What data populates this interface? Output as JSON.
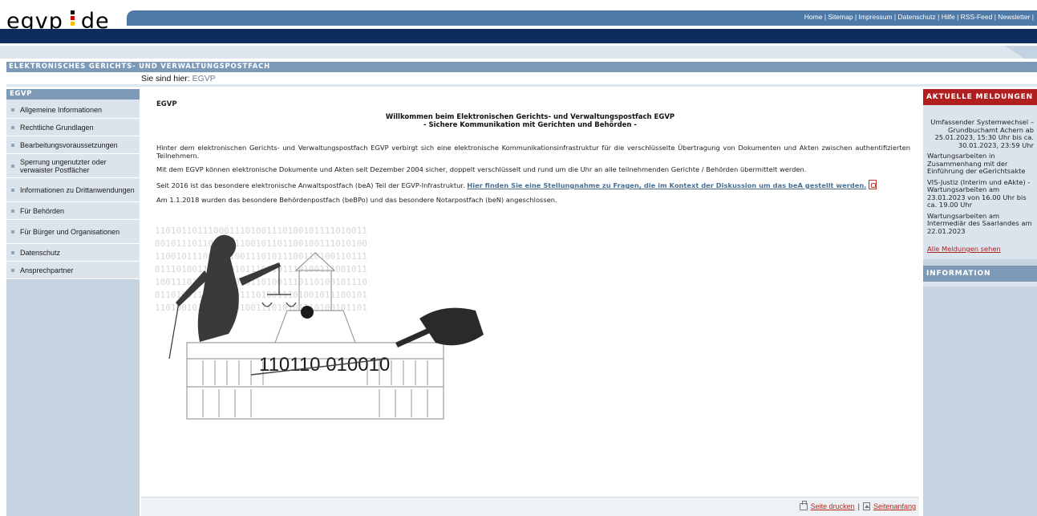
{
  "header": {
    "logo_left": "egvp",
    "logo_right": "de",
    "top_links": [
      "Home",
      "Sitemap",
      "Impressum",
      "Datenschutz",
      "Hilfe",
      "RSS-Feed",
      "Newsletter"
    ]
  },
  "title_bar": "ELEKTRONISCHES GERICHTS- UND VERWALTUNGSPOSTFACH",
  "breadcrumb": {
    "label": "Sie sind hier:",
    "current": "EGVP"
  },
  "sidebar": {
    "heading": "EGVP",
    "items": [
      {
        "label": "Allgemeine Informationen"
      },
      {
        "label": "Rechtliche Grundlagen"
      },
      {
        "label": "Bearbeitungsvoraussetzungen"
      },
      {
        "label": "Sperrung ungenutzter oder verwaister Postfächer"
      },
      {
        "label": "Informationen zu Drittanwendungen"
      },
      {
        "label": "Für Behörden"
      },
      {
        "label": "Für Bürger und Organisationen"
      },
      {
        "label": "Datenschutz"
      },
      {
        "label": "Ansprechpartner"
      }
    ]
  },
  "main": {
    "heading": "EGVP",
    "welcome_line1": "Willkommen beim Elektronischen Gerichts- und Verwaltungspostfach EGVP",
    "welcome_line2": "- Sichere Kommunikation mit Gerichten und Behörden -",
    "p1": "Hinter dem elektronischen Gerichts- und Verwaltungspostfach EGVP verbirgt sich eine elektronische Kommunikationsinfrastruktur für die verschlüsselte Übertragung von Dokumenten und Akten zwischen authentifizierten Teilnehmern.",
    "p2": "Mit dem EGVP können elektronische Dokumente und Akten seit Dezember 2004 sicher, doppelt verschlüsselt und rund um die Uhr an alle teilnehmenden Gerichte / Behörden übermittelt werden.",
    "p3_text": "Seit 2016 ist das besondere elektronische Anwaltspostfach (beA) Teil der EGVP-Infrastruktur. ",
    "p3_link": "Hier finden Sie eine Stellungnahme zu Fragen, die im Kontext der Diskussion um das beA gestellt werden.",
    "p4": "Am 1.1.2018 wurden das besondere Behördenpostfach (beBPo) und das besondere Notarpostfach (beN) angeschlossen.",
    "image_binary_text": "110110 010010",
    "pdf_icon": "pdf-icon"
  },
  "footer": {
    "print_label": "Seite drucken",
    "separator": "|",
    "top_label": "Seitenanfang"
  },
  "right": {
    "news_heading": "AKTUELLE MELDUNGEN",
    "news": [
      "Umfassender Systemwechsel – Grundbuchamt Achern ab 25.01.2023, 15:30 Uhr bis ca. 30.01.2023, 23:59 Uhr",
      "Wartungsarbeiten in Zusammenhang mit der Einführung der eGerichtsakte",
      "VIS-Justiz (Interim und eAkte) - Wartungsarbeiten am 23.01.2023 von 16.00 Uhr bis ca. 19.00 Uhr",
      "Wartungsarbeiten am Intermediär des Saarlandes am 22.01.2023"
    ],
    "all_news": "Alle Meldungen sehen",
    "info_heading": "INFORMATION"
  },
  "colors": {
    "header_blue": "#4f79a6",
    "navy": "#0d2b5e",
    "sidebar_bg": "#c6d4e1",
    "news_red": "#b01e1e"
  }
}
